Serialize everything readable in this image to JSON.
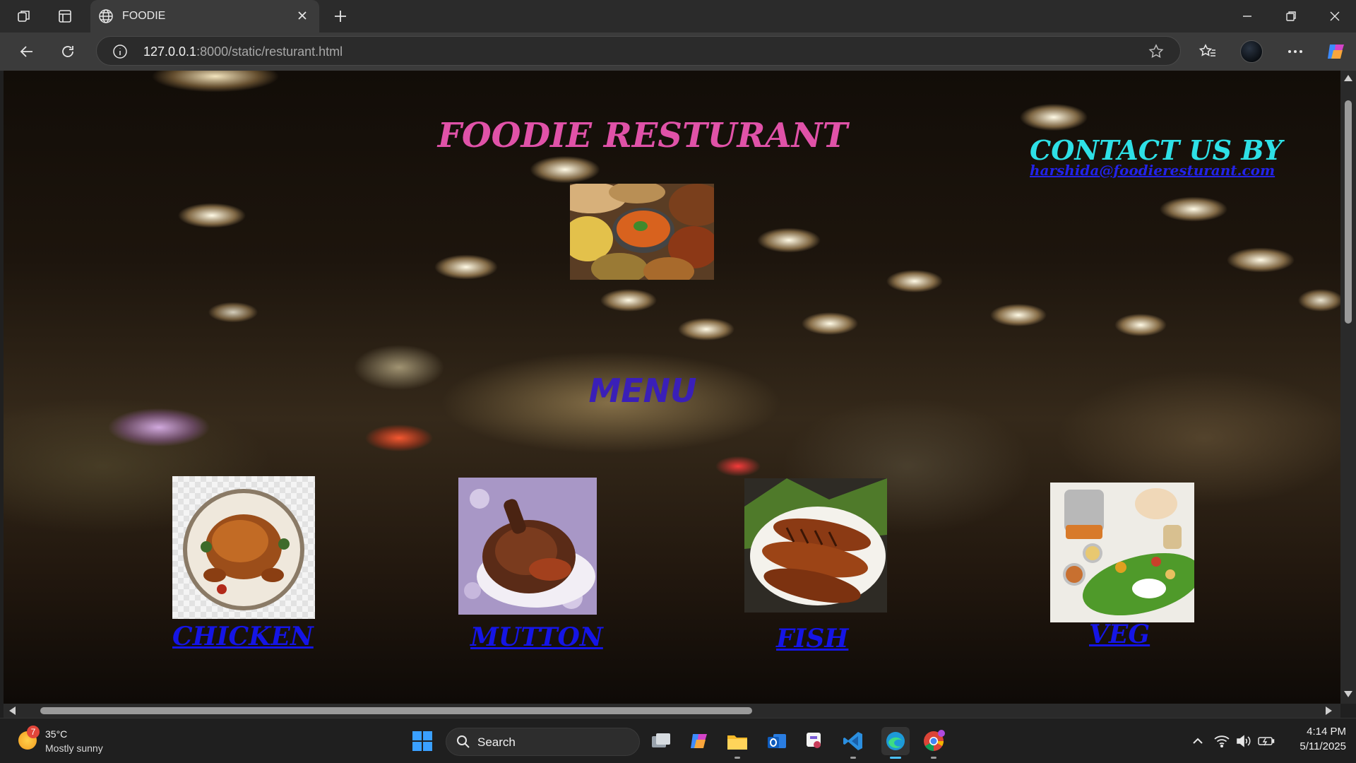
{
  "browser": {
    "tab_title": "FOODIE",
    "url_host": "127.0.0.1",
    "url_rest": ":8000/static/resturant.html"
  },
  "page": {
    "title": "FOODIE RESTURANT",
    "contact_title": "CONTACT US BY",
    "contact_email": "harshida@foodieresturant.com",
    "menu_heading": "MENU",
    "items": [
      {
        "label": "CHICKEN"
      },
      {
        "label": "MUTTON"
      },
      {
        "label": "FISH"
      },
      {
        "label": "VEG"
      }
    ]
  },
  "taskbar": {
    "weather_temp": "35°C",
    "weather_desc": "Mostly sunny",
    "weather_badge": "7",
    "search_label": "Search",
    "time": "4:14 PM",
    "date": "5/11/2025"
  }
}
